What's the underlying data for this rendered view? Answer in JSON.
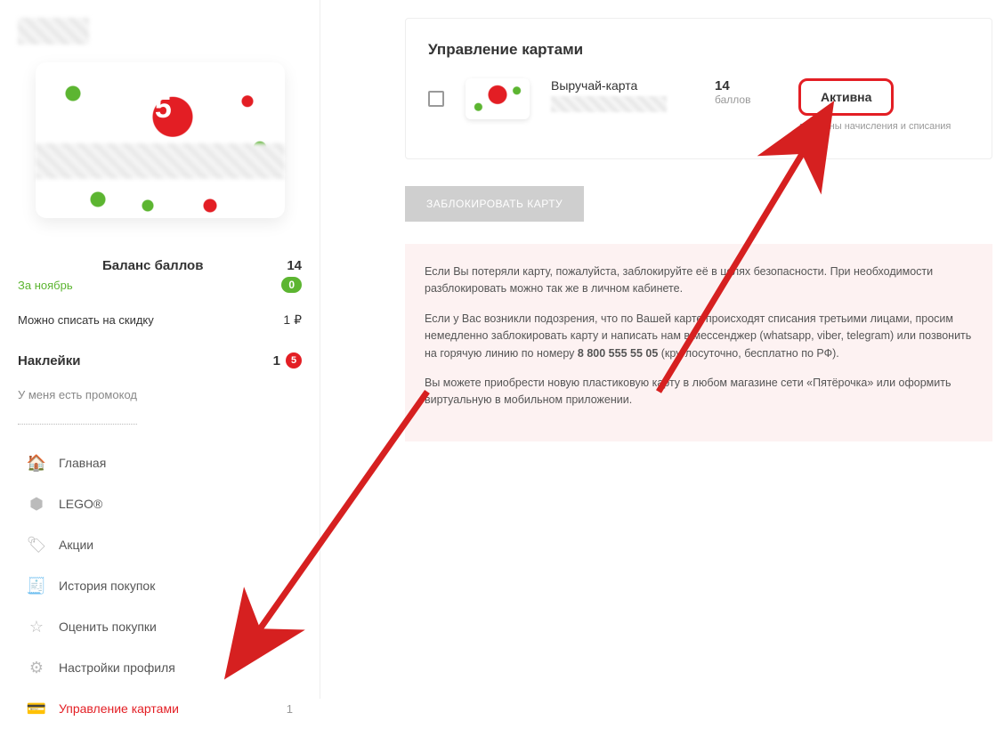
{
  "sidebar": {
    "balance_label": "Баланс баллов",
    "balance_value": "14",
    "month_label": "За ноябрь",
    "month_value": "0",
    "discount_label": "Можно списать на скидку",
    "discount_value": "1 ₽",
    "stickers_label": "Наклейки",
    "stickers_count": "1",
    "promo_link": "У меня есть промокод",
    "nav": [
      {
        "icon": "home-icon",
        "glyph": "🏠",
        "label": "Главная"
      },
      {
        "icon": "lego-icon",
        "glyph": "⬢",
        "label": "LEGO®"
      },
      {
        "icon": "tag-icon",
        "glyph": "🏷",
        "label": "Акции"
      },
      {
        "icon": "receipt-icon",
        "glyph": "🧾",
        "label": "История покупок"
      },
      {
        "icon": "star-icon",
        "glyph": "☆",
        "label": "Оценить покупки"
      },
      {
        "icon": "gear-icon",
        "glyph": "⚙",
        "label": "Настройки профиля"
      },
      {
        "icon": "cards-icon",
        "glyph": "💳",
        "label": "Управление картами",
        "count": "1",
        "active": true
      }
    ]
  },
  "main": {
    "panel_title": "Управление картами",
    "card": {
      "name": "Выручай-карта",
      "points_value": "14",
      "points_label": "баллов",
      "status": "Активна",
      "status_sub": "доступны начисления и списания"
    },
    "block_button": "ЗАБЛОКИРОВАТЬ КАРТУ",
    "info": {
      "p1": "Если Вы потеряли карту, пожалуйста, заблокируйте её в целях безопасности. При необходимости разблокировать можно так же в личном кабинете.",
      "p2a": "Если у Вас возникли подозрения, что по Вашей карте происходят списания третьими лицами, просим немедленно заблокировать карту и написать нам в мессенджер (whatsapp, viber, telegram) или позвонить на горячую линию по номеру ",
      "p2_phone": "8 800 555 55 05",
      "p2b": " (круглосуточно, бесплатно по РФ).",
      "p3": "Вы можете приобрести новую пластиковую карту в любом магазине сети «Пятёрочка» или оформить виртуальную в мобильном приложении."
    }
  }
}
